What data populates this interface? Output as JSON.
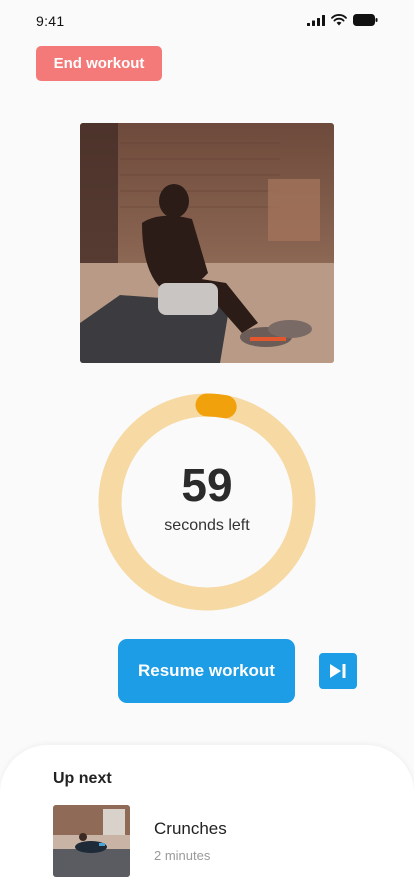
{
  "status_bar": {
    "time": "9:41",
    "icons": [
      "signal-icon",
      "wifi-icon",
      "battery-icon"
    ]
  },
  "actions": {
    "end_label": "End workout",
    "resume_label": "Resume workout",
    "skip_icon": "skip-next-icon"
  },
  "exercise_image": "man doing sit-ups on a mat in a brick-walled gym",
  "timer": {
    "value": "59",
    "label": "seconds left",
    "progress": 0.03
  },
  "up_next": {
    "title": "Up next",
    "name": "Crunches",
    "duration": "2 minutes"
  },
  "colors": {
    "accent": "#1d9de6",
    "danger": "#f47a7a",
    "ring_track": "#f6d9a3",
    "ring_progress": "#f0a10c"
  }
}
